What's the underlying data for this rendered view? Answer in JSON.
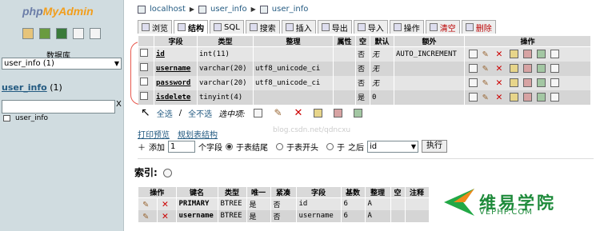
{
  "sidebar": {
    "logo_a": "php",
    "logo_b": "MyAdmin",
    "db_label": "数据库",
    "db_selected": "user_info (1)",
    "db_heading": "user_info",
    "db_count": "(1)",
    "filter_clear": "X",
    "table_item": "user_info"
  },
  "breadcrumb": [
    "localhost",
    "user_info",
    "user_info"
  ],
  "tabs": [
    {
      "label": "浏览"
    },
    {
      "label": "结构"
    },
    {
      "label": "SQL"
    },
    {
      "label": "搜索"
    },
    {
      "label": "插入"
    },
    {
      "label": "导出"
    },
    {
      "label": "导入"
    },
    {
      "label": "操作"
    },
    {
      "label": "清空"
    },
    {
      "label": "删除"
    }
  ],
  "structure": {
    "headers": [
      "",
      "字段",
      "类型",
      "整理",
      "属性",
      "空",
      "默认",
      "额外",
      "操作"
    ],
    "rows": [
      {
        "name": "id",
        "type": "int(11)",
        "collation": "",
        "attr": "",
        "null": "否",
        "default": "无",
        "extra": "AUTO_INCREMENT"
      },
      {
        "name": "username",
        "type": "varchar(20)",
        "collation": "utf8_unicode_ci",
        "attr": "",
        "null": "否",
        "default": "无",
        "extra": ""
      },
      {
        "name": "password",
        "type": "varchar(20)",
        "collation": "utf8_unicode_ci",
        "attr": "",
        "null": "否",
        "default": "无",
        "extra": ""
      },
      {
        "name": "isdelete",
        "type": "tinyint(4)",
        "collation": "",
        "attr": "",
        "null": "是",
        "default": "0",
        "extra": ""
      }
    ]
  },
  "selection": {
    "all": "全选",
    "sep": "/",
    "none": "全不选",
    "with_selected": "选中项:"
  },
  "links": {
    "print": "打印预览",
    "plan": "规划表结构"
  },
  "watermark": "blog.csdn.net/qdncxu",
  "add": {
    "label": "添加",
    "count": "1",
    "unit": "个字段",
    "opt_end": "于表结尾",
    "opt_start": "于表开头",
    "opt_after": "于",
    "after_label": "之后",
    "after_field": "id",
    "go": "执行"
  },
  "indexes": {
    "title": "索引:",
    "headers": [
      "操作",
      "键名",
      "类型",
      "唯一",
      "紧凑",
      "字段",
      "基数",
      "整理",
      "空",
      "注释"
    ],
    "rows": [
      {
        "key": "PRIMARY",
        "type": "BTREE",
        "unique": "是",
        "packed": "否",
        "field": "id",
        "card": "6",
        "coll": "A",
        "null": "",
        "comment": ""
      },
      {
        "key": "username",
        "type": "BTREE",
        "unique": "是",
        "packed": "否",
        "field": "username",
        "card": "6",
        "coll": "A",
        "null": "",
        "comment": ""
      }
    ]
  },
  "brand": {
    "cn": "维易学院",
    "en": "VEPHP.COM"
  }
}
